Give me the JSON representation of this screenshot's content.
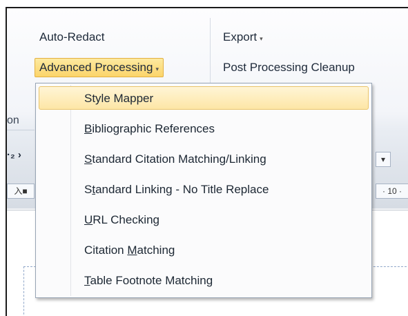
{
  "ribbon": {
    "auto_redact": "Auto-Redact",
    "advanced_processing": "Advanced Processing",
    "export": "Export",
    "post_processing_cleanup": "Post Processing Cleanup",
    "group_label_fragment": "on",
    "dropdown_glyph": "▾"
  },
  "toolbar": {
    "glyph_left": "·₂ ›",
    "font_field_fragment": "入■",
    "font_size": "· 10 ·",
    "combo_arrow": "▾"
  },
  "menu": {
    "items": [
      {
        "pre": "",
        "key": "",
        "post": "Style Mapper",
        "highlighted": true
      },
      {
        "pre": "",
        "key": "B",
        "post": "ibliographic References",
        "highlighted": false
      },
      {
        "pre": "",
        "key": "S",
        "post": "tandard Citation Matching/Linking",
        "highlighted": false
      },
      {
        "pre": "S",
        "key": "t",
        "post": "andard Linking - No Title Replace",
        "highlighted": false
      },
      {
        "pre": "",
        "key": "U",
        "post": "RL Checking",
        "highlighted": false
      },
      {
        "pre": "Citation ",
        "key": "M",
        "post": "atching",
        "highlighted": false
      },
      {
        "pre": "",
        "key": "T",
        "post": "able Footnote Matching",
        "highlighted": false
      }
    ]
  },
  "colors": {
    "highlight_top": "#fff5d6",
    "highlight_bottom": "#fde6a6",
    "highlight_border": "#e9c46a",
    "menu_border": "#97a4b4"
  },
  "icons": [
    "chevron-down-icon"
  ]
}
